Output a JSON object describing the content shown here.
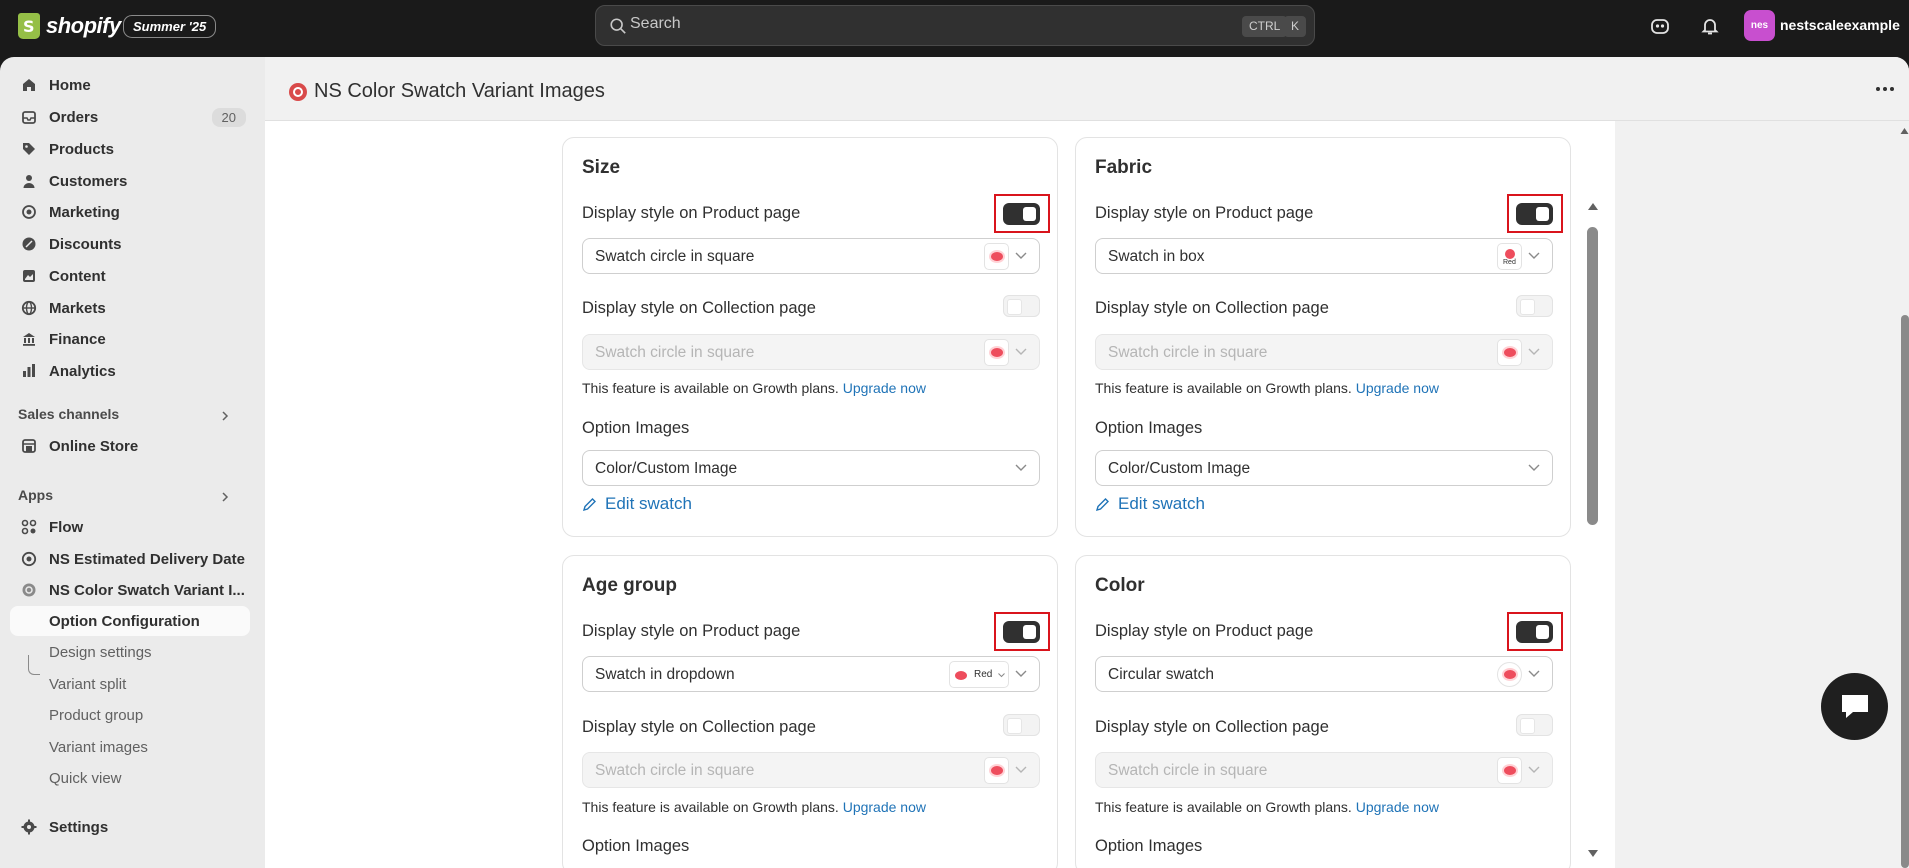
{
  "topbar": {
    "brand": "shopify",
    "badge": "Summer '25",
    "search_placeholder": "Search",
    "kbd_ctrl": "CTRL",
    "kbd_k": "K",
    "avatar_initials": "nes",
    "username": "nestscaleexample"
  },
  "sidebar": {
    "items": [
      {
        "label": "Home",
        "icon": "home-icon"
      },
      {
        "label": "Orders",
        "icon": "orders-icon",
        "count": "20"
      },
      {
        "label": "Products",
        "icon": "tag-icon"
      },
      {
        "label": "Customers",
        "icon": "person-icon"
      },
      {
        "label": "Marketing",
        "icon": "target-icon"
      },
      {
        "label": "Discounts",
        "icon": "discount-icon"
      },
      {
        "label": "Content",
        "icon": "content-icon"
      },
      {
        "label": "Markets",
        "icon": "globe-icon"
      },
      {
        "label": "Finance",
        "icon": "bank-icon"
      },
      {
        "label": "Analytics",
        "icon": "chart-icon"
      }
    ],
    "sales_channels_title": "Sales channels",
    "online_store": "Online Store",
    "apps_title": "Apps",
    "apps": [
      {
        "label": "Flow"
      },
      {
        "label": "NS Estimated Delivery Date"
      },
      {
        "label": "NS Color Swatch Variant I..."
      }
    ],
    "subitems": [
      "Option Configuration",
      "Design settings",
      "Variant split",
      "Product group",
      "Variant images",
      "Quick view"
    ],
    "settings": "Settings"
  },
  "page": {
    "title": "NS Color Swatch Variant Images"
  },
  "common": {
    "product_label": "Display style on Product page",
    "collection_label": "Display style on Collection page",
    "note_text": "This feature is available on Growth plans.",
    "upgrade": "Upgrade now",
    "option_images": "Option Images",
    "edit_swatch": "Edit swatch",
    "collection_value": "Swatch circle in square",
    "option_images_value": "Color/Custom Image"
  },
  "cards": [
    {
      "title": "Size",
      "product_value": "Swatch circle in square",
      "product_on": true
    },
    {
      "title": "Fabric",
      "product_value": "Swatch in box",
      "product_on": true,
      "swatch_label": "Red"
    },
    {
      "title": "Age group",
      "product_value": "Swatch in dropdown",
      "product_on": true,
      "swatch_label": "Red"
    },
    {
      "title": "Color",
      "product_value": "Circular swatch",
      "product_on": true
    }
  ],
  "colors": {
    "accent": "#1f73b7",
    "highlight": "#d9141c",
    "swatch_red": "#ee4d5d",
    "topbar": "#1a1a1a"
  }
}
